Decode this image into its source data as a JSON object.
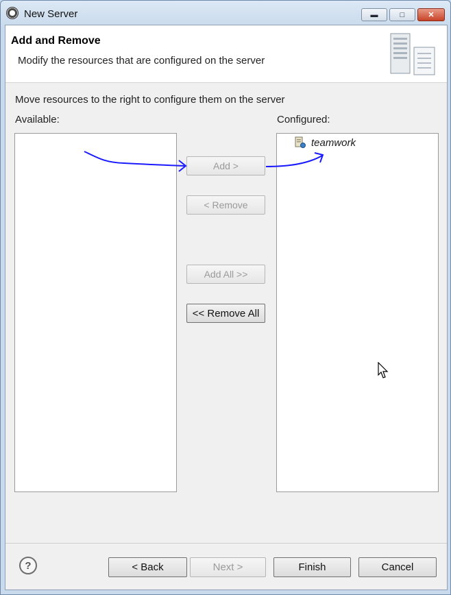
{
  "window": {
    "title": "New Server"
  },
  "header": {
    "title": "Add and Remove",
    "description": "Modify the resources that are configured on the server"
  },
  "main": {
    "instruction": "Move resources to the right to configure them on the server",
    "available_label": "Available:",
    "configured_label": "Configured:",
    "available_items": [],
    "configured_items": [
      {
        "label": "teamwork"
      }
    ]
  },
  "buttons": {
    "add": "Add >",
    "remove": "< Remove",
    "add_all": "Add All >>",
    "remove_all": "<< Remove All",
    "back": "< Back",
    "next": "Next >",
    "finish": "Finish",
    "cancel": "Cancel",
    "help": "?"
  },
  "colors": {
    "annotation_arrow": "#1a1aff",
    "finish_highlight": "#f3f312"
  }
}
